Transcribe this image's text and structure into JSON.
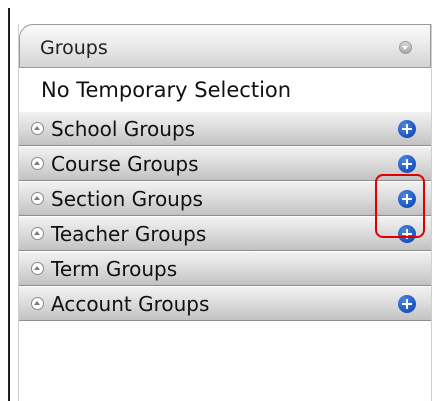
{
  "panel": {
    "title": "Groups",
    "temporary_selection": "No Temporary Selection"
  },
  "groups": [
    {
      "label": "School Groups"
    },
    {
      "label": "Course Groups"
    },
    {
      "label": "Section Groups"
    },
    {
      "label": "Teacher Groups"
    },
    {
      "label": "Term Groups"
    },
    {
      "label": "Account Groups"
    }
  ],
  "colors": {
    "add_button": "#1f5bc4",
    "highlight": "#e00000",
    "row_gradient_top": "#f2f2f2",
    "row_gradient_bottom": "#c2c2c2"
  },
  "icons": {
    "header_toggle": "collapse-circle-icon",
    "row_toggle": "expand-circle-icon",
    "row_action": "plus-circle-icon"
  }
}
